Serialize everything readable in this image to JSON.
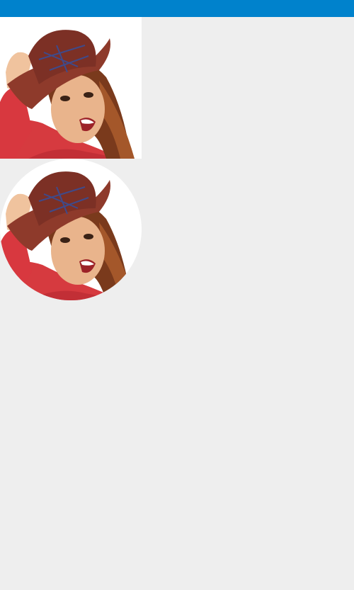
{
  "app_bar": {
    "color": "#0082cc"
  },
  "content": {
    "background": "#eeeeee",
    "images": [
      {
        "icon": "portrait-photo",
        "shape": "square"
      },
      {
        "icon": "portrait-photo",
        "shape": "circle"
      }
    ]
  }
}
